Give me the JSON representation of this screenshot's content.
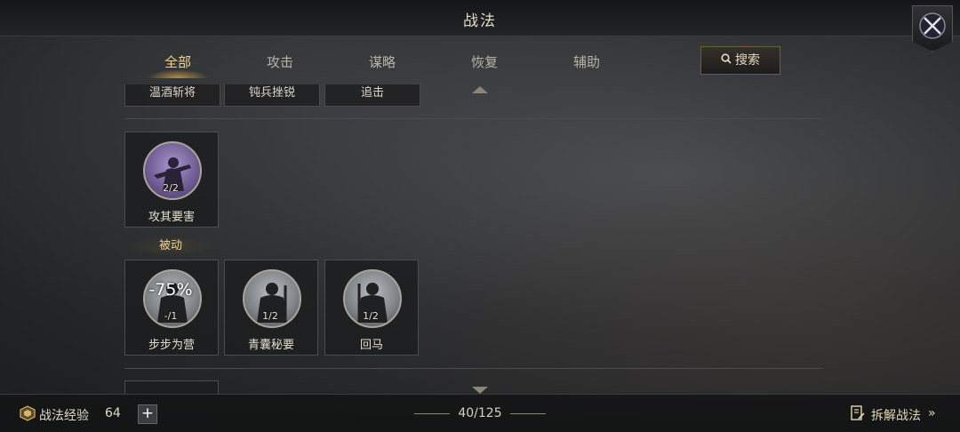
{
  "header": {
    "title": "战法"
  },
  "tabs": [
    {
      "label": "全部",
      "active": true
    },
    {
      "label": "攻击",
      "active": false
    },
    {
      "label": "谋略",
      "active": false
    },
    {
      "label": "恢复",
      "active": false
    },
    {
      "label": "辅助",
      "active": false
    }
  ],
  "search": {
    "label": "搜索"
  },
  "top_row": [
    "温酒斩将",
    "钝兵挫锐",
    "追击"
  ],
  "section1": {
    "cards": [
      {
        "name": "攻其要害",
        "count": "2/2"
      }
    ]
  },
  "section2": {
    "label": "被动",
    "cards": [
      {
        "name": "步步为营",
        "count": "-/1",
        "percent": "-75%"
      },
      {
        "name": "青囊秘要",
        "count": "1/2"
      },
      {
        "name": "回马",
        "count": "1/2"
      }
    ]
  },
  "footer": {
    "exp_label": "战法经验",
    "exp_value": "64",
    "plus": "+",
    "page": "40/125",
    "decompose_label": "拆解战法",
    "decompose_chevron": "»"
  },
  "colors": {
    "accent": "#f1d48a",
    "text": "#d9d2c3"
  }
}
